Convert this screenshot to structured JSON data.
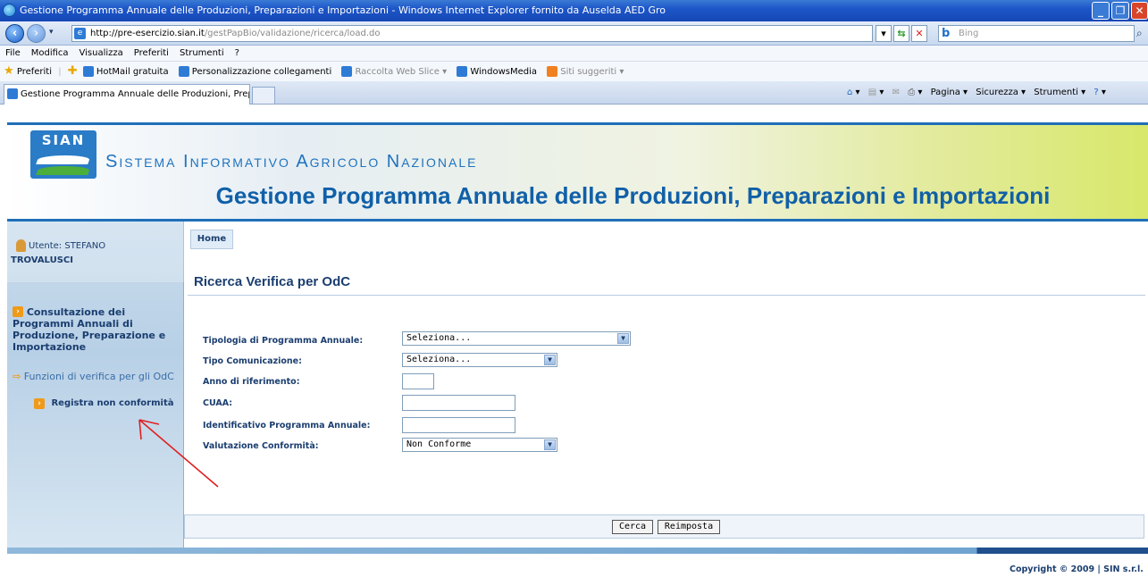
{
  "browser": {
    "window_title": "Gestione Programma Annuale delle Produzioni, Preparazioni e Importazioni - Windows Internet Explorer fornito da Auselda AED Gro",
    "url_host": "http://pre-esercizio.sian.it",
    "url_path": "/gestPapBio/validazione/ricerca/load.do",
    "search_placeholder": "Bing",
    "menu": [
      "File",
      "Modifica",
      "Visualizza",
      "Preferiti",
      "Strumenti",
      "?"
    ],
    "favorites_label": "Preferiti",
    "favorites": [
      {
        "label": "HotMail gratuita",
        "dim": false
      },
      {
        "label": "Personalizzazione collegamenti",
        "dim": false
      },
      {
        "label": "Raccolta Web Slice ▾",
        "dim": true
      },
      {
        "label": "WindowsMedia",
        "dim": false
      },
      {
        "label": "Siti suggeriti ▾",
        "dim": true
      }
    ],
    "tab_title": "Gestione Programma Annuale delle Produzioni, Prepar...",
    "commands": {
      "page": "Pagina ▾",
      "security": "Sicurezza ▾",
      "tools": "Strumenti ▾"
    }
  },
  "header": {
    "logo_text": "SIAN",
    "system_name": "Sistema Informativo Agricolo Nazionale",
    "app_title": "Gestione Programma Annuale delle Produzioni, Preparazioni e Importazioni"
  },
  "sidebar": {
    "user_label": "Utente: STEFANO",
    "user_surname": "TROVALUSCI",
    "nav_section": "Consultazione dei Programmi Annuali di Produzione, Preparazione e Importazione",
    "nav_sub": "Funzioni di verifica per gli OdC",
    "nav_item": "Registra non conformità"
  },
  "main": {
    "home_tab": "Home",
    "page_title": "Ricerca Verifica per OdC",
    "fields": {
      "tipologia_label": "Tipologia di Programma Annuale:",
      "tipologia_value": "Seleziona...",
      "tipo_comunicazione_label": "Tipo Comunicazione:",
      "tipo_comunicazione_value": "Seleziona...",
      "anno_label": "Anno di riferimento:",
      "anno_value": "",
      "cuaa_label": "CUAA:",
      "cuaa_value": "",
      "identificativo_label": "Identificativo Programma Annuale:",
      "identificativo_value": "",
      "valutazione_label": "Valutazione Conformità:",
      "valutazione_value": "Non Conforme"
    },
    "buttons": {
      "search": "Cerca",
      "reset": "Reimposta"
    }
  },
  "footer": {
    "copyright": "Copyright © 2009 | SIN s.r.l."
  },
  "colors": {
    "brand_blue": "#1060a8",
    "nav_text": "#1b3e70",
    "annotation_arrow": "#e02020"
  }
}
